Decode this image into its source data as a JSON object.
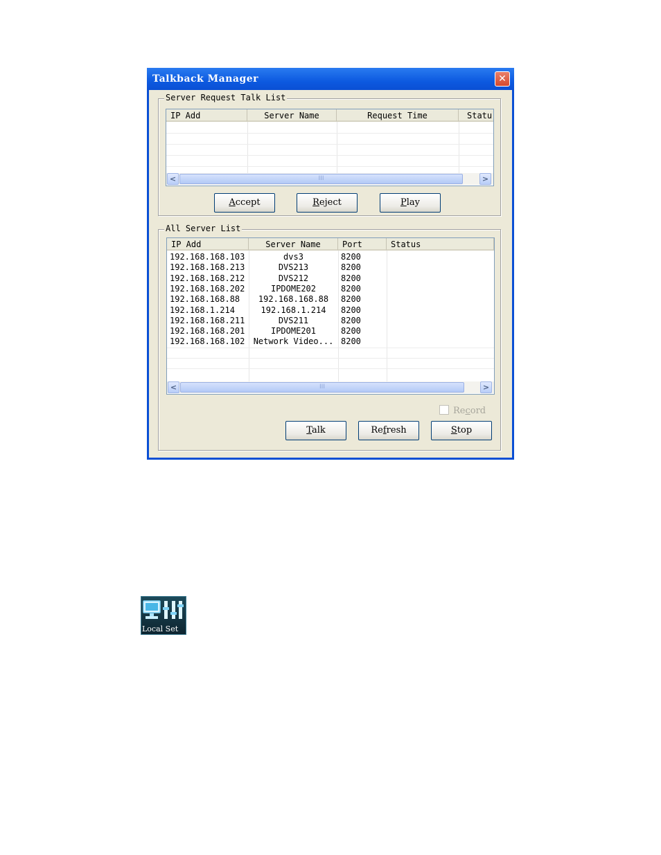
{
  "window": {
    "title": "Talkback Manager",
    "close_glyph": "✕",
    "title_color": "#0a4fd4"
  },
  "request_group": {
    "legend": "Server Request Talk List",
    "columns": [
      "IP Add",
      "Server Name",
      "Request Time",
      "Statu"
    ],
    "rows": [],
    "scroll_thumb_glyph": "III",
    "buttons": {
      "accept": {
        "mnemonic": "A",
        "rest": "ccept"
      },
      "reject": {
        "mnemonic": "R",
        "rest": "eject"
      },
      "play": {
        "mnemonic": "P",
        "rest": "lay"
      }
    }
  },
  "all_group": {
    "legend": "All Server List",
    "columns": [
      "IP Add",
      "Server Name",
      "Port",
      "Status"
    ],
    "rows": [
      {
        "ip": "192.168.168.103",
        "name": "dvs3",
        "port": "8200",
        "status": ""
      },
      {
        "ip": "192.168.168.213",
        "name": "DVS213",
        "port": "8200",
        "status": ""
      },
      {
        "ip": "192.168.168.212",
        "name": "DVS212",
        "port": "8200",
        "status": ""
      },
      {
        "ip": "192.168.168.202",
        "name": "IPDOME202",
        "port": "8200",
        "status": ""
      },
      {
        "ip": "192.168.168.88",
        "name": "192.168.168.88",
        "port": "8200",
        "status": ""
      },
      {
        "ip": "192.168.1.214",
        "name": "192.168.1.214",
        "port": "8200",
        "status": ""
      },
      {
        "ip": "192.168.168.211",
        "name": "DVS211",
        "port": "8200",
        "status": ""
      },
      {
        "ip": "192.168.168.201",
        "name": "IPDOME201",
        "port": "8200",
        "status": ""
      },
      {
        "ip": "192.168.168.102",
        "name": "Network Video...",
        "port": "8200",
        "status": ""
      }
    ],
    "scroll_thumb_glyph": "III",
    "record": {
      "before": "Re",
      "mnemonic": "c",
      "after": "ord",
      "checked": false,
      "enabled": false
    },
    "buttons": {
      "talk": {
        "mnemonic": "T",
        "rest": "alk"
      },
      "refresh": {
        "before": "Re",
        "mnemonic": "f",
        "after": "resh"
      },
      "stop": {
        "mnemonic": "S",
        "rest": "top"
      }
    }
  },
  "desktop_icon": {
    "label": "Local Set",
    "icon": "local-settings-icon"
  }
}
